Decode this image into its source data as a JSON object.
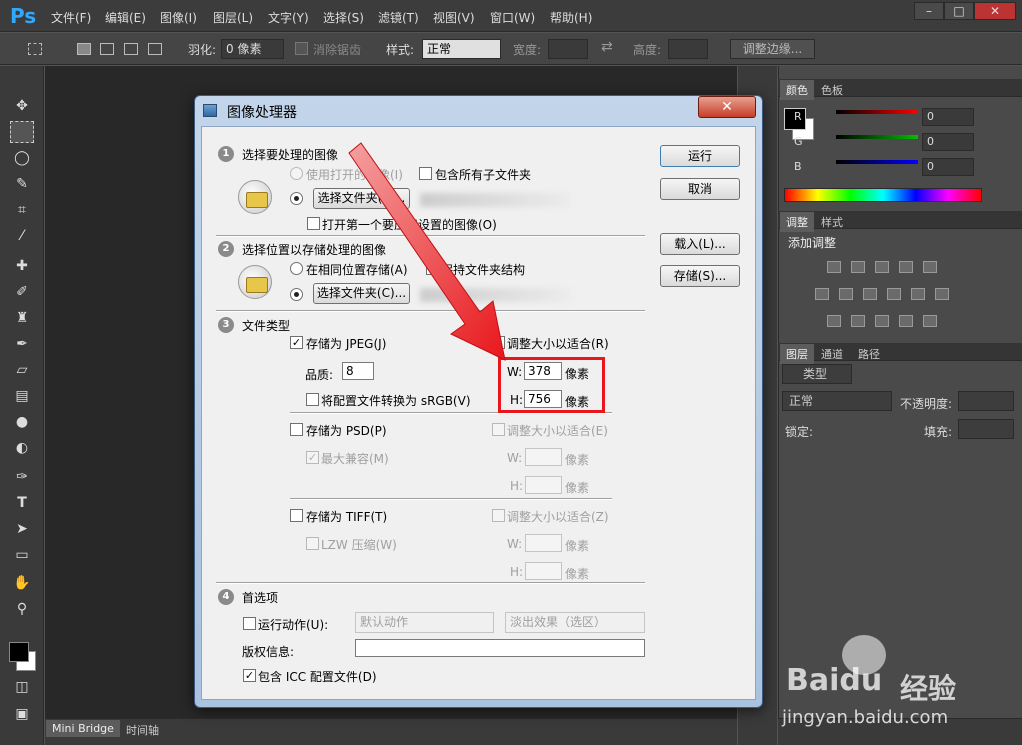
{
  "app": {
    "logo": "Ps"
  },
  "menu": [
    "文件(F)",
    "编辑(E)",
    "图像(I)",
    "图层(L)",
    "文字(Y)",
    "选择(S)",
    "滤镜(T)",
    "视图(V)",
    "窗口(W)",
    "帮助(H)"
  ],
  "window_buttons": {
    "minimize": "–",
    "maximize": "□",
    "close": "✕"
  },
  "options": {
    "feather_label": "羽化:",
    "feather_value": "0 像素",
    "antialias_label": "消除锯齿",
    "style_label": "样式:",
    "style_value": "正常",
    "width_label": "宽度:",
    "swap_icon": "⇄",
    "height_label": "高度:",
    "refine_edge": "调整边缘..."
  },
  "panels": {
    "color_tabs": [
      "颜色",
      "色板"
    ],
    "rgb": [
      {
        "label": "R",
        "value": "0",
        "color": "#ff0000"
      },
      {
        "label": "G",
        "value": "0",
        "color": "#00c000"
      },
      {
        "label": "B",
        "value": "0",
        "color": "#0000ff"
      }
    ],
    "adjust_tabs": [
      "调整",
      "样式"
    ],
    "add_adjustment": "添加调整",
    "layers_tabs": [
      "图层",
      "通道",
      "路径"
    ],
    "kind_filter": "类型",
    "blend_mode": "正常",
    "opacity_label": "不透明度:",
    "lock_label": "锁定:",
    "fill_label": "填充:"
  },
  "bottom_tabs": [
    "Mini Bridge",
    "时间轴"
  ],
  "dialog": {
    "title": "图像处理器",
    "close": "✕",
    "section1": {
      "num": "1",
      "title": "选择要处理的图像",
      "use_open": "使用打开的图像(I)",
      "include_subfolders": "包含所有子文件夹",
      "select_folder_btn": "选择文件夹(F)...",
      "open_first": "打开第一个要应用设置的图像(O)"
    },
    "section2": {
      "num": "2",
      "title": "选择位置以存储处理的图像",
      "same_location": "在相同位置存储(A)",
      "keep_structure": "保持文件夹结构",
      "select_folder_btn": "选择文件夹(C)..."
    },
    "section3": {
      "num": "3",
      "title": "文件类型",
      "jpeg": "存储为 JPEG(J)",
      "jpeg_resize": "调整大小以适合(R)",
      "quality_label": "品质:",
      "quality_value": "8",
      "w_label": "W:",
      "w_value": "378",
      "h_label": "H:",
      "h_value": "756",
      "unit": "像素",
      "srgb": "将配置文件转换为 sRGB(V)",
      "psd": "存储为 PSD(P)",
      "psd_resize": "调整大小以适合(E)",
      "max_compat": "最大兼容(M)",
      "tiff": "存储为 TIFF(T)",
      "tiff_resize": "调整大小以适合(Z)",
      "lzw": "LZW 压缩(W)"
    },
    "section4": {
      "num": "4",
      "title": "首选项",
      "run_action": "运行动作(U):",
      "action_set": "默认动作",
      "action": "淡出效果（选区）",
      "copyright_label": "版权信息:",
      "icc": "包含 ICC 配置文件(D)"
    },
    "buttons": {
      "run": "运行",
      "cancel": "取消",
      "load": "载入(L)...",
      "save": "存储(S)..."
    }
  },
  "watermark": {
    "brand": "Baidu",
    "brand_cn": "经验",
    "url": "jingyan.baidu.com"
  }
}
